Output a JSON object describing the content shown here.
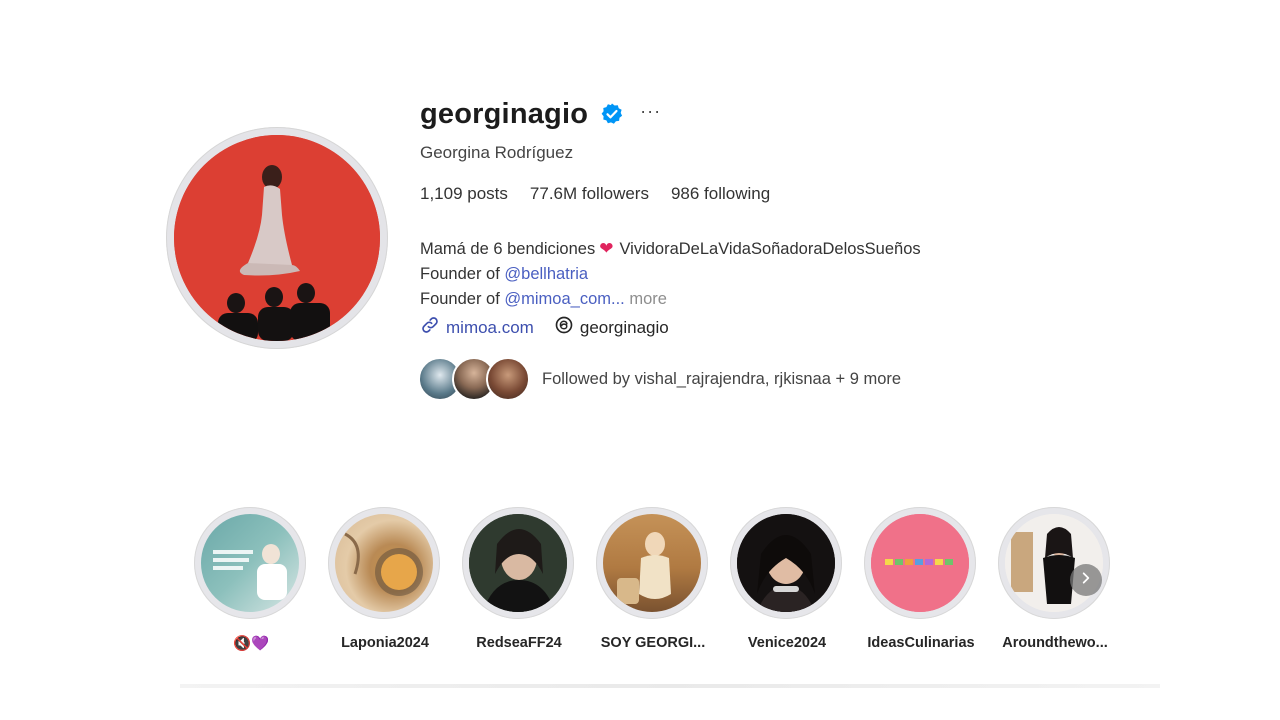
{
  "profile": {
    "username": "georginagio",
    "full_name": "Georgina Rodríguez",
    "more_label": "···",
    "verified_icon": "verified-badge-icon",
    "accent_color": "#0095f6"
  },
  "stats": {
    "posts": "1,109 posts",
    "followers": "77.6M followers",
    "following": "986 following"
  },
  "bio": {
    "line1_text": "Mamá de 6 bendiciones",
    "line1_heart": "❤",
    "line1_suffix": "VividoraDeLaVidaSoñadoraDelosSueños",
    "line2_prefix": "Founder of ",
    "line2_mention": "@bellhatria",
    "line3_prefix": "Founder of ",
    "line3_mention": "@mimoa_com...",
    "line3_more": "more"
  },
  "links": {
    "website": "mimoa.com",
    "threads": "georginagio"
  },
  "followed_by": {
    "text": "Followed by vishal_rajrajendra, rjkisnaa + 9 more"
  },
  "highlights": [
    {
      "label": "🔇💜"
    },
    {
      "label": "Laponia2024"
    },
    {
      "label": "RedseaFF24"
    },
    {
      "label": "SOY GEORGI..."
    },
    {
      "label": "Venice2024"
    },
    {
      "label": "IdeasCulinarias"
    },
    {
      "label": "Aroundthewo..."
    }
  ]
}
